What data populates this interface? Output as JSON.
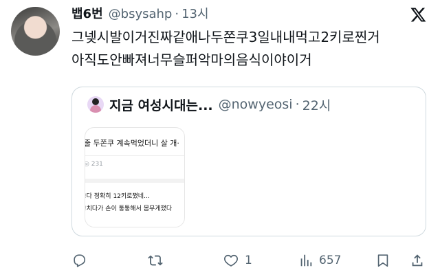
{
  "tweet": {
    "author_name": "뱁6번",
    "handle": "@bsysahp",
    "separator": "·",
    "time": "13시",
    "text_lines": [
      "그넺시발이거진짜같애나두쫀쿠3일내내먹고2키로찐거",
      "아직도안빠져너무슬퍼악마의음식이야이거"
    ]
  },
  "quoted": {
    "author_name": "지금 여성시대는...",
    "handle": "@nowyeosi",
    "separator": "·",
    "time": "22시",
    "image_text": {
      "line1": "줄 두쫀쿠 계속먹었더니 살 개·",
      "views": "◎ 231",
      "line2": "!다 정확히 12키로쪘네...",
      "line3": "!치다가 손이 퉁퉁해서 몸무게쟀다"
    }
  },
  "actions": {
    "reply_icon": "reply-icon",
    "retweet_icon": "retweet-icon",
    "like_icon": "heart-icon",
    "like_count": "1",
    "views_icon": "views-icon",
    "views_count": "657",
    "bookmark_icon": "bookmark-icon",
    "share_icon": "share-icon"
  },
  "colors": {
    "text": "#0f1419",
    "secondary": "#536471",
    "border": "#cfd9de"
  }
}
